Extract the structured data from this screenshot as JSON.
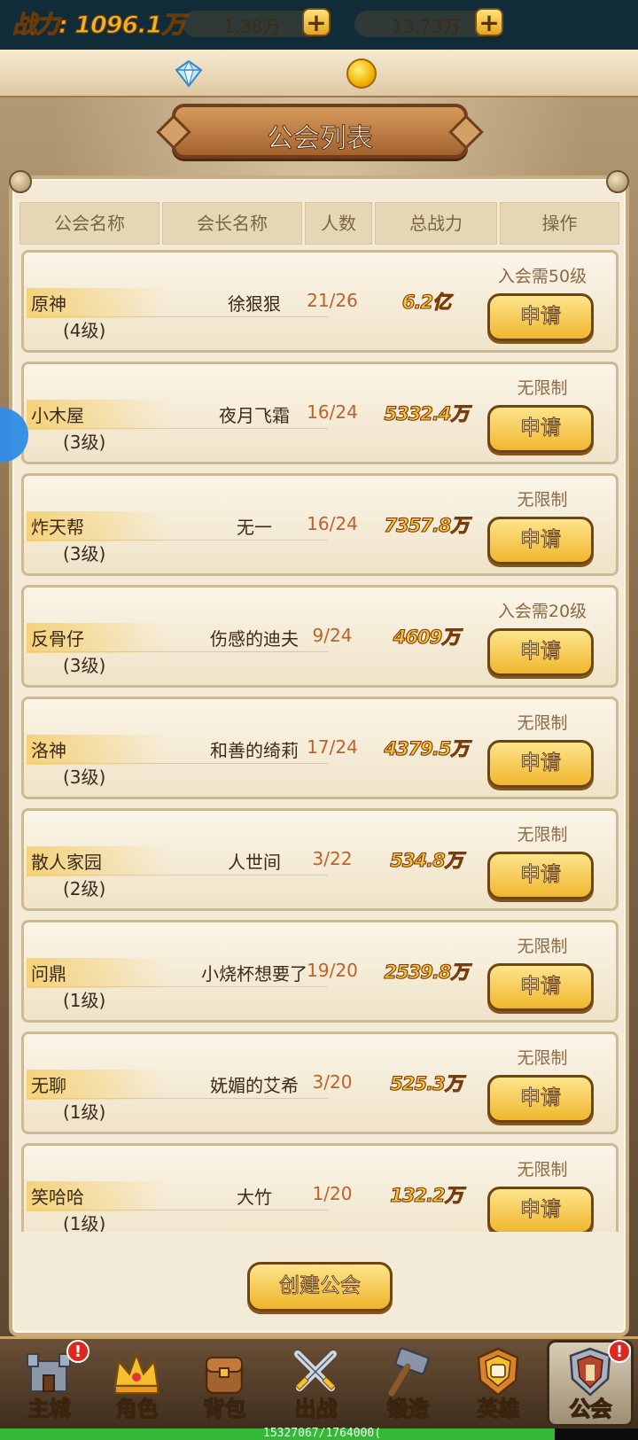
{
  "top": {
    "power_label": "战力: 1096.1万",
    "gems": "1.38万",
    "coins": "13.73万",
    "plus": "+"
  },
  "title": "公会列表",
  "headers": [
    "公会名称",
    "会长名称",
    "人数",
    "总战力",
    "操作"
  ],
  "guilds": [
    {
      "name": "原神",
      "level": "(4级)",
      "leader": "徐狠狠",
      "members": "21/26",
      "power": "6.2亿",
      "requirement": "入会需50级",
      "button": "申请"
    },
    {
      "name": "小木屋",
      "level": "(3级)",
      "leader": "夜月飞霜",
      "members": "16/24",
      "power": "5332.4万",
      "requirement": "无限制",
      "button": "申请"
    },
    {
      "name": "炸天帮",
      "level": "(3级)",
      "leader": "无一",
      "members": "16/24",
      "power": "7357.8万",
      "requirement": "无限制",
      "button": "申请"
    },
    {
      "name": "反骨仔",
      "level": "(3级)",
      "leader": "伤感的迪夫",
      "members": "9/24",
      "power": "4609万",
      "requirement": "入会需20级",
      "button": "申请"
    },
    {
      "name": "洛神",
      "level": "(3级)",
      "leader": "和善的绮莉",
      "members": "17/24",
      "power": "4379.5万",
      "requirement": "无限制",
      "button": "申请"
    },
    {
      "name": "散人家园",
      "level": "(2级)",
      "leader": "人世间",
      "members": "3/22",
      "power": "534.8万",
      "requirement": "无限制",
      "button": "申请"
    },
    {
      "name": "问鼎",
      "level": "(1级)",
      "leader": "小烧杯想要了",
      "members": "19/20",
      "power": "2539.8万",
      "requirement": "无限制",
      "button": "申请"
    },
    {
      "name": "无聊",
      "level": "(1级)",
      "leader": "妩媚的艾希",
      "members": "3/20",
      "power": "525.3万",
      "requirement": "无限制",
      "button": "申请"
    },
    {
      "name": "笑哈哈",
      "level": "(1级)",
      "leader": "大竹",
      "members": "1/20",
      "power": "132.2万",
      "requirement": "无限制",
      "button": "申请"
    }
  ],
  "create_button": "创建公会",
  "nav": [
    {
      "label": "主城",
      "icon": "castle-icon",
      "badge": "!"
    },
    {
      "label": "角色",
      "icon": "crown-icon",
      "badge": ""
    },
    {
      "label": "背包",
      "icon": "bag-icon",
      "badge": ""
    },
    {
      "label": "出战",
      "icon": "crossed-swords-icon",
      "badge": ""
    },
    {
      "label": "锻造",
      "icon": "hammer-icon",
      "badge": ""
    },
    {
      "label": "英雄",
      "icon": "hero-fist-icon",
      "badge": ""
    },
    {
      "label": "公会",
      "icon": "guild-shield-icon",
      "badge": "!"
    }
  ],
  "exp": {
    "text": "15327067/1764000(",
    "fraction": 0.869
  },
  "colors": {
    "accent_gold": "#f0b72d",
    "member_count": "#c0612a",
    "exp_green": "#35b838"
  }
}
